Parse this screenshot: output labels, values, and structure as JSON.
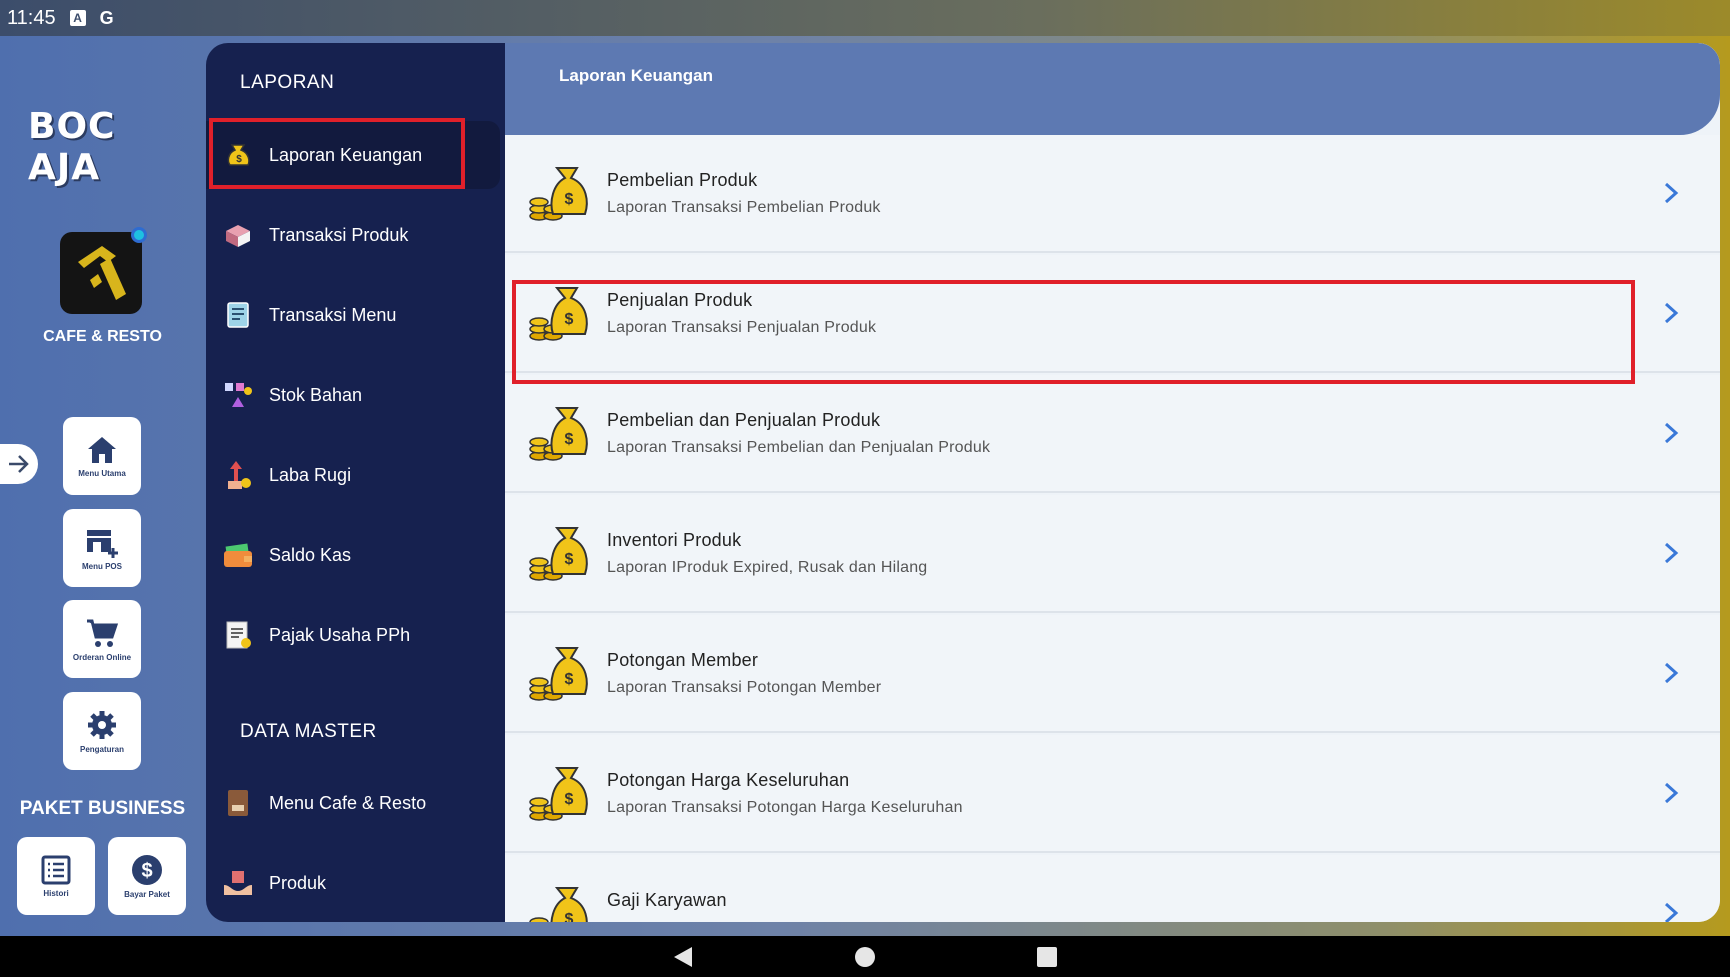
{
  "status": {
    "time": "11:45",
    "a_icon": "A",
    "g_icon": "G"
  },
  "brand": {
    "logo_text": "BOC AJA",
    "app_label": "CAFE & RESTO"
  },
  "rail": {
    "buttons": [
      {
        "label": "Menu Utama",
        "icon": "home-icon"
      },
      {
        "label": "Menu POS",
        "icon": "pos-icon"
      },
      {
        "label": "Orderan Online",
        "icon": "cart-icon"
      },
      {
        "label": "Pengaturan",
        "icon": "gear-icon"
      }
    ],
    "package_label": "PAKET BUSINESS",
    "package_buttons": [
      {
        "label": "Histori",
        "icon": "list-icon"
      },
      {
        "label": "Bayar Paket",
        "icon": "dollar-icon"
      }
    ]
  },
  "nav": {
    "section1": "LAPORAN",
    "items1": [
      {
        "label": "Laporan Keuangan",
        "icon": "money-bag-icon"
      },
      {
        "label": "Transaksi Produk",
        "icon": "box-icon"
      },
      {
        "label": "Transaksi Menu",
        "icon": "menu-board-icon"
      },
      {
        "label": "Stok Bahan",
        "icon": "stock-icon"
      },
      {
        "label": "Laba Rugi",
        "icon": "profit-icon"
      },
      {
        "label": "Saldo Kas",
        "icon": "wallet-icon"
      },
      {
        "label": "Pajak Usaha PPh",
        "icon": "tax-icon"
      }
    ],
    "section2": "DATA MASTER",
    "items2": [
      {
        "label": "Menu Cafe & Resto",
        "icon": "menu-book-icon"
      },
      {
        "label": "Produk",
        "icon": "product-icon"
      }
    ]
  },
  "main": {
    "title": "Laporan Keuangan",
    "rows": [
      {
        "title": "Pembelian Produk",
        "subtitle": "Laporan Transaksi Pembelian Produk"
      },
      {
        "title": "Penjualan Produk",
        "subtitle": "Laporan Transaksi Penjualan Produk"
      },
      {
        "title": "Pembelian dan Penjualan Produk",
        "subtitle": "Laporan Transaksi Pembelian dan Penjualan Produk"
      },
      {
        "title": "Inventori Produk",
        "subtitle": "Laporan IProduk Expired, Rusak dan Hilang"
      },
      {
        "title": "Potongan Member",
        "subtitle": "Laporan Transaksi Potongan Member"
      },
      {
        "title": "Potongan Harga Keseluruhan",
        "subtitle": "Laporan Transaksi Potongan Harga Keseluruhan"
      },
      {
        "title": "Gaji Karyawan",
        "subtitle": ""
      }
    ]
  },
  "colors": {
    "nav_bg": "#16214f",
    "header_bg": "#5d79b2",
    "highlight": "#e0202a",
    "chevron": "#3a78d8"
  }
}
